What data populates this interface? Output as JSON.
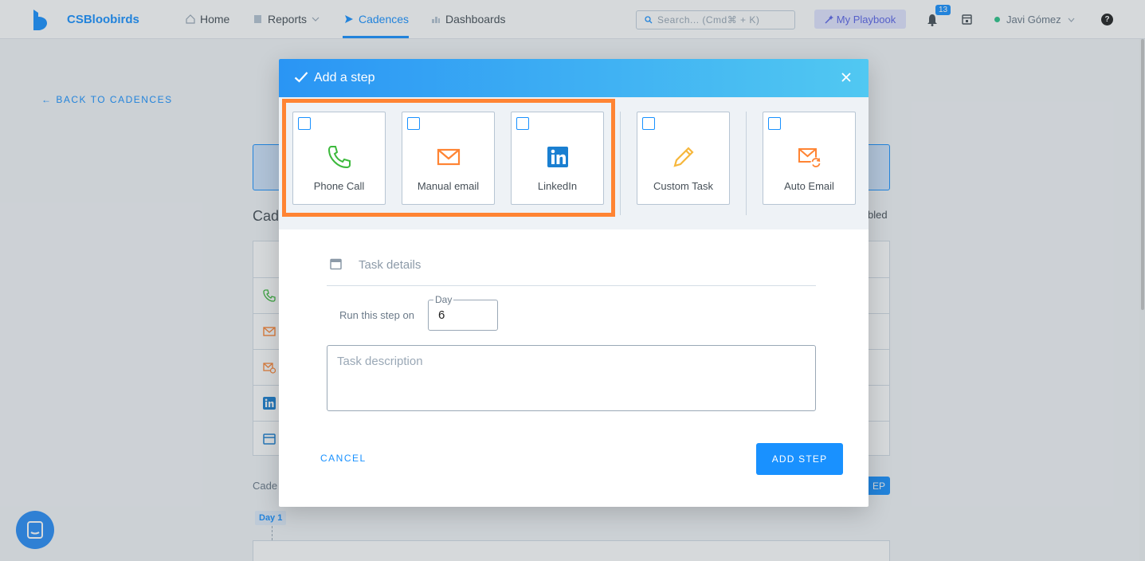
{
  "nav": {
    "brand": "CSBloobirds",
    "items": [
      {
        "label": "Home",
        "icon": "home-icon"
      },
      {
        "label": "Reports",
        "icon": "reports-icon"
      },
      {
        "label": "Cadences",
        "icon": "send-icon"
      },
      {
        "label": "Dashboards",
        "icon": "dashboard-icon"
      }
    ],
    "search_placeholder": "Search... (Cmd⌘ + K)",
    "playbook_label": "My Playbook",
    "notifications_count": "13",
    "user_name": "Javi Gómez",
    "help_label": "?",
    "accent": "#1991ff"
  },
  "page": {
    "back_link": "BACK TO CADENCES",
    "cadence_title": "Cad",
    "enabled_text": "bled",
    "cadence_label": "Cade",
    "step_button_fragment": "EP",
    "day_label": "Day 1"
  },
  "modal": {
    "title": "Add a step",
    "step_types": [
      {
        "label": "Phone Call",
        "icon": "phone-icon",
        "color": "#3cb93c"
      },
      {
        "label": "Manual email",
        "icon": "email-icon",
        "color": "#ff8433"
      },
      {
        "label": "LinkedIn",
        "icon": "linkedin-icon",
        "color": "#1a7fd1"
      },
      {
        "label": "Custom Task",
        "icon": "pencil-icon",
        "color": "#f6b73c"
      },
      {
        "label": "Auto Email",
        "icon": "auto-email-icon",
        "color": "#ff8433"
      }
    ],
    "highlight_color": "#ff8433",
    "task_details_label": "Task details",
    "run_step_label": "Run this step on",
    "day_field_legend": "Day",
    "day_field_value": "6",
    "description_placeholder": "Task description",
    "cancel_label": "CANCEL",
    "add_step_label": "ADD STEP"
  }
}
